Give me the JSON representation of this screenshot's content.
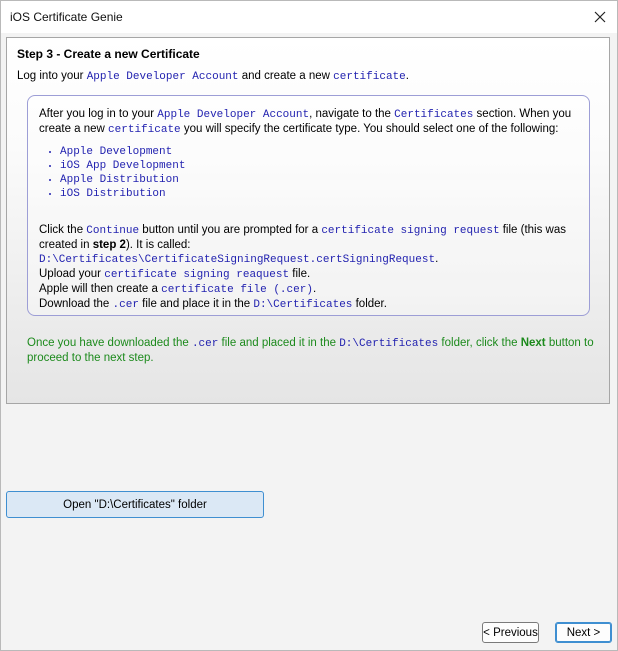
{
  "window": {
    "title": "iOS Certificate Genie"
  },
  "step": {
    "title": "Step 3 - Create a new Certificate",
    "intro": {
      "t1": "Log into your ",
      "m1": "Apple Developer Account",
      "t2": " and create a new ",
      "m2": "certificate",
      "t3": "."
    }
  },
  "info": {
    "p1": {
      "t1": "After you log in to your ",
      "m1": "Apple Developer Account",
      "t2": ", navigate to the ",
      "m2": "Certificates",
      "t3": " section. When you create a new ",
      "m3": "certificate",
      "t4": " you will specify the certificate type. You should select one of the following:"
    },
    "types": [
      "Apple Development",
      "iOS App Development",
      "Apple Distribution",
      "iOS Distribution"
    ],
    "p2": {
      "t1": "Click the ",
      "m1": "Continue",
      "t2": " button until you are prompted for a ",
      "m2": "certificate signing request",
      "t3": " file (this was created in ",
      "b1": "step 2",
      "t4": "). It is called:",
      "m3": "D:\\Certificates\\CertificateSigningRequest.certSigningRequest",
      "t5": ".",
      "t6": "Upload your ",
      "m4": "certificate signing reaquest",
      "t7": " file.",
      "t8": "Apple will then create a ",
      "m5": "certificate file (.cer)",
      "t9": ".",
      "t10": "Download the ",
      "m6": ".cer",
      "t11": " file and place it in the ",
      "m7": "D:\\Certificates",
      "t12": " folder."
    }
  },
  "note": {
    "t1": "Once you have downloaded the ",
    "m1": ".cer",
    "t2": " file and placed it in the ",
    "m2": "D:\\Certificates",
    "t3": " folder, click the ",
    "b1": "Next",
    "t4": " button to proceed to the next step."
  },
  "buttons": {
    "open_folder": "Open \"D:\\Certificates\" folder",
    "previous": "< Previous",
    "next": "Next >"
  },
  "colors": {
    "accent": "#3f8fd1",
    "mono_text": "#2323b0",
    "note_text": "#1c8a1c",
    "info_border": "#9d9ed6"
  },
  "icons": {
    "close": "close-icon"
  }
}
